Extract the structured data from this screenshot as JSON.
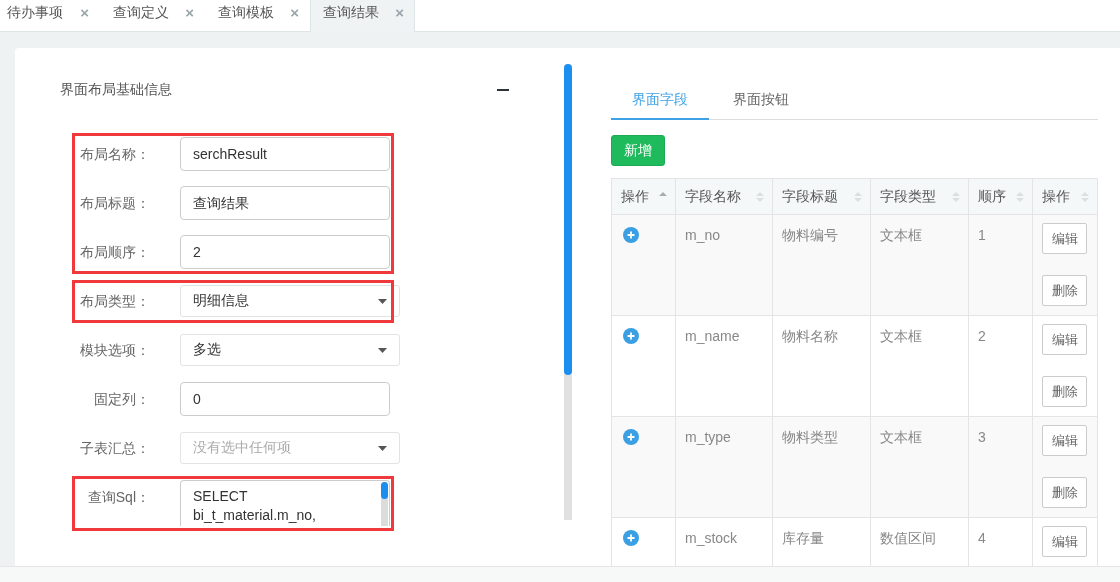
{
  "tabs": [
    {
      "label": "待办事项",
      "close": "×",
      "selected": false
    },
    {
      "label": "查询定义",
      "close": "×",
      "selected": false
    },
    {
      "label": "查询模板",
      "close": "×",
      "selected": false
    },
    {
      "label": "查询结果",
      "close": "×",
      "selected": true
    }
  ],
  "layout_panel": {
    "title": "界面布局基础信息",
    "groups": [
      {
        "highlighted": true,
        "fields": [
          {
            "kind": "input",
            "label": "布局名称：",
            "value": "serchResult"
          },
          {
            "kind": "input",
            "label": "布局标题：",
            "value": "查询结果"
          },
          {
            "kind": "input",
            "label": "布局顺序：",
            "value": "2"
          }
        ]
      },
      {
        "highlighted": true,
        "fields": [
          {
            "kind": "select",
            "label": "布局类型：",
            "value": "明细信息"
          }
        ]
      },
      {
        "highlighted": false,
        "fields": [
          {
            "kind": "select",
            "label": "模块选项：",
            "value": "多选"
          },
          {
            "kind": "input",
            "label": "固定列：",
            "value": "0"
          },
          {
            "kind": "select",
            "label": "子表汇总：",
            "placeholder": "没有选中任何项"
          }
        ]
      },
      {
        "highlighted": true,
        "fields": [
          {
            "kind": "textarea",
            "label": "查询Sql：",
            "value": "SELECT\nbi_t_material.m_no,"
          }
        ]
      }
    ]
  },
  "field_panel": {
    "tabs": [
      {
        "label": "界面字段",
        "selected": true
      },
      {
        "label": "界面按钮",
        "selected": false
      }
    ],
    "add_button": "新增",
    "table": {
      "columns": [
        {
          "label": "操作",
          "sorted": true
        },
        {
          "label": "字段名称",
          "sorted": false
        },
        {
          "label": "字段标题",
          "sorted": false
        },
        {
          "label": "字段类型",
          "sorted": false
        },
        {
          "label": "顺序",
          "sorted": false
        },
        {
          "label": "操作",
          "sorted": false
        }
      ],
      "rows": [
        {
          "name": "m_no",
          "title": "物料编号",
          "type": "文本框",
          "order": "1",
          "actions": [
            "编辑",
            "删除"
          ]
        },
        {
          "name": "m_name",
          "title": "物料名称",
          "type": "文本框",
          "order": "2",
          "actions": [
            "编辑",
            "删除"
          ]
        },
        {
          "name": "m_type",
          "title": "物料类型",
          "type": "文本框",
          "order": "3",
          "actions": [
            "编辑",
            "删除"
          ]
        },
        {
          "name": "m_stock",
          "title": "库存量",
          "type": "数值区间",
          "order": "4",
          "actions": [
            "编辑"
          ]
        }
      ]
    }
  }
}
